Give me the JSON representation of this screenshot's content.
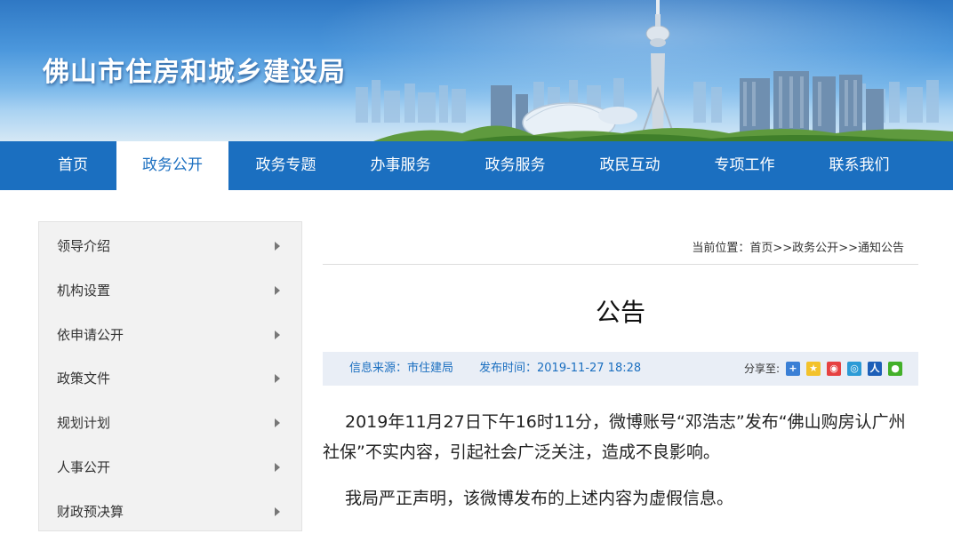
{
  "site": {
    "title": "佛山市住房和城乡建设局"
  },
  "nav": {
    "items": [
      {
        "label": "首页"
      },
      {
        "label": "政务公开",
        "active": true
      },
      {
        "label": "政务专题"
      },
      {
        "label": "办事服务"
      },
      {
        "label": "政务服务"
      },
      {
        "label": "政民互动"
      },
      {
        "label": "专项工作"
      },
      {
        "label": "联系我们"
      }
    ]
  },
  "sidebar": {
    "items": [
      {
        "label": "领导介绍"
      },
      {
        "label": "机构设置"
      },
      {
        "label": "依申请公开"
      },
      {
        "label": "政策文件"
      },
      {
        "label": "规划计划"
      },
      {
        "label": "人事公开"
      },
      {
        "label": "财政预决算"
      }
    ]
  },
  "breadcrumb": {
    "prefix": "当前位置：",
    "items": [
      "首页",
      "政务公开",
      "通知公告"
    ],
    "separator": ">>"
  },
  "article": {
    "title": "公告",
    "source": "信息来源：市住建局",
    "publish_time": "发布时间：2019-11-27 18:28",
    "share_label": "分享至:",
    "share_icons": [
      "share-more-icon",
      "qzone-icon",
      "weibo-icon",
      "tencent-weibo-icon",
      "renren-icon",
      "wechat-icon"
    ],
    "paragraphs": [
      "2019年11月27日下午16时11分，微博账号“邓浩志”发布“佛山购房认广州社保”不实内容，引起社会广泛关注，造成不良影响。",
      "我局严正声明，该微博发布的上述内容为虚假信息。"
    ]
  },
  "colors": {
    "nav_bg": "#1b6fc0",
    "accent": "#1b6fc0",
    "sidebar_bg": "#f2f2f2",
    "meta_bar_bg": "#e9eef6"
  }
}
